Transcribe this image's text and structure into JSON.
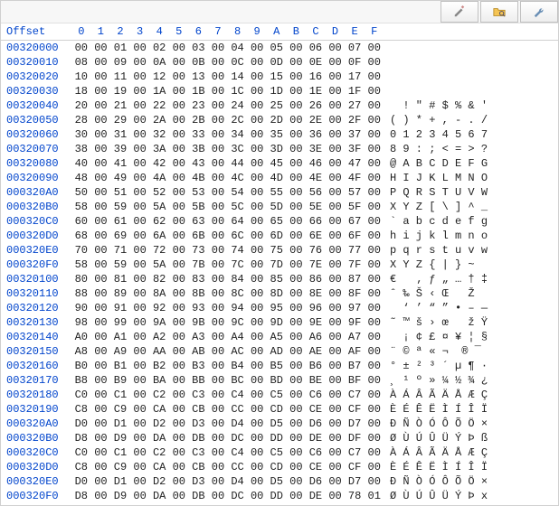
{
  "headers": {
    "offset_label": "Offset",
    "hex_cols": [
      "0",
      "1",
      "2",
      "3",
      "4",
      "5",
      "6",
      "7",
      "8",
      "9",
      "A",
      "B",
      "C",
      "D",
      "E",
      "F"
    ]
  },
  "rows": [
    {
      "offset": "00320000",
      "hex": [
        "00",
        "00",
        "01",
        "00",
        "02",
        "00",
        "03",
        "00",
        "04",
        "00",
        "05",
        "00",
        "06",
        "00",
        "07",
        "00"
      ],
      "asc": "                "
    },
    {
      "offset": "00320010",
      "hex": [
        "08",
        "00",
        "09",
        "00",
        "0A",
        "00",
        "0B",
        "00",
        "0C",
        "00",
        "0D",
        "00",
        "0E",
        "00",
        "0F",
        "00"
      ],
      "asc": "                "
    },
    {
      "offset": "00320020",
      "hex": [
        "10",
        "00",
        "11",
        "00",
        "12",
        "00",
        "13",
        "00",
        "14",
        "00",
        "15",
        "00",
        "16",
        "00",
        "17",
        "00"
      ],
      "asc": "                "
    },
    {
      "offset": "00320030",
      "hex": [
        "18",
        "00",
        "19",
        "00",
        "1A",
        "00",
        "1B",
        "00",
        "1C",
        "00",
        "1D",
        "00",
        "1E",
        "00",
        "1F",
        "00"
      ],
      "asc": "                "
    },
    {
      "offset": "00320040",
      "hex": [
        "20",
        "00",
        "21",
        "00",
        "22",
        "00",
        "23",
        "00",
        "24",
        "00",
        "25",
        "00",
        "26",
        "00",
        "27",
        "00"
      ],
      "asc": "  ! \" # $ % & ' "
    },
    {
      "offset": "00320050",
      "hex": [
        "28",
        "00",
        "29",
        "00",
        "2A",
        "00",
        "2B",
        "00",
        "2C",
        "00",
        "2D",
        "00",
        "2E",
        "00",
        "2F",
        "00"
      ],
      "asc": "( ) * + , - . / "
    },
    {
      "offset": "00320060",
      "hex": [
        "30",
        "00",
        "31",
        "00",
        "32",
        "00",
        "33",
        "00",
        "34",
        "00",
        "35",
        "00",
        "36",
        "00",
        "37",
        "00"
      ],
      "asc": "0 1 2 3 4 5 6 7 "
    },
    {
      "offset": "00320070",
      "hex": [
        "38",
        "00",
        "39",
        "00",
        "3A",
        "00",
        "3B",
        "00",
        "3C",
        "00",
        "3D",
        "00",
        "3E",
        "00",
        "3F",
        "00"
      ],
      "asc": "8 9 : ; < = > ? "
    },
    {
      "offset": "00320080",
      "hex": [
        "40",
        "00",
        "41",
        "00",
        "42",
        "00",
        "43",
        "00",
        "44",
        "00",
        "45",
        "00",
        "46",
        "00",
        "47",
        "00"
      ],
      "asc": "@ A B C D E F G "
    },
    {
      "offset": "00320090",
      "hex": [
        "48",
        "00",
        "49",
        "00",
        "4A",
        "00",
        "4B",
        "00",
        "4C",
        "00",
        "4D",
        "00",
        "4E",
        "00",
        "4F",
        "00"
      ],
      "asc": "H I J K L M N O "
    },
    {
      "offset": "000320A0",
      "hex": [
        "50",
        "00",
        "51",
        "00",
        "52",
        "00",
        "53",
        "00",
        "54",
        "00",
        "55",
        "00",
        "56",
        "00",
        "57",
        "00"
      ],
      "asc": "P Q R S T U V W "
    },
    {
      "offset": "000320B0",
      "hex": [
        "58",
        "00",
        "59",
        "00",
        "5A",
        "00",
        "5B",
        "00",
        "5C",
        "00",
        "5D",
        "00",
        "5E",
        "00",
        "5F",
        "00"
      ],
      "asc": "X Y Z [ \\ ] ^ _ "
    },
    {
      "offset": "000320C0",
      "hex": [
        "60",
        "00",
        "61",
        "00",
        "62",
        "00",
        "63",
        "00",
        "64",
        "00",
        "65",
        "00",
        "66",
        "00",
        "67",
        "00"
      ],
      "asc": "` a b c d e f g "
    },
    {
      "offset": "000320D0",
      "hex": [
        "68",
        "00",
        "69",
        "00",
        "6A",
        "00",
        "6B",
        "00",
        "6C",
        "00",
        "6D",
        "00",
        "6E",
        "00",
        "6F",
        "00"
      ],
      "asc": "h i j k l m n o "
    },
    {
      "offset": "000320E0",
      "hex": [
        "70",
        "00",
        "71",
        "00",
        "72",
        "00",
        "73",
        "00",
        "74",
        "00",
        "75",
        "00",
        "76",
        "00",
        "77",
        "00"
      ],
      "asc": "p q r s t u v w "
    },
    {
      "offset": "000320F0",
      "hex": [
        "58",
        "00",
        "59",
        "00",
        "5A",
        "00",
        "7B",
        "00",
        "7C",
        "00",
        "7D",
        "00",
        "7E",
        "00",
        "7F",
        "00"
      ],
      "asc": "X Y Z { | } ~   "
    },
    {
      "offset": "00320100",
      "hex": [
        "80",
        "00",
        "81",
        "00",
        "82",
        "00",
        "83",
        "00",
        "84",
        "00",
        "85",
        "00",
        "86",
        "00",
        "87",
        "00"
      ],
      "asc": "€   ‚ ƒ „ … † ‡ "
    },
    {
      "offset": "00320110",
      "hex": [
        "88",
        "00",
        "89",
        "00",
        "8A",
        "00",
        "8B",
        "00",
        "8C",
        "00",
        "8D",
        "00",
        "8E",
        "00",
        "8F",
        "00"
      ],
      "asc": "ˆ ‰ Š ‹ Œ   Ž   "
    },
    {
      "offset": "00320120",
      "hex": [
        "90",
        "00",
        "91",
        "00",
        "92",
        "00",
        "93",
        "00",
        "94",
        "00",
        "95",
        "00",
        "96",
        "00",
        "97",
        "00"
      ],
      "asc": "  ‘ ’ “ ” • – — "
    },
    {
      "offset": "00320130",
      "hex": [
        "98",
        "00",
        "99",
        "00",
        "9A",
        "00",
        "9B",
        "00",
        "9C",
        "00",
        "9D",
        "00",
        "9E",
        "00",
        "9F",
        "00"
      ],
      "asc": "˜ ™ š › œ   ž Ÿ "
    },
    {
      "offset": "00320140",
      "hex": [
        "A0",
        "00",
        "A1",
        "00",
        "A2",
        "00",
        "A3",
        "00",
        "A4",
        "00",
        "A5",
        "00",
        "A6",
        "00",
        "A7",
        "00"
      ],
      "asc": "  ¡ ¢ £ ¤ ¥ ¦ § "
    },
    {
      "offset": "00320150",
      "hex": [
        "A8",
        "00",
        "A9",
        "00",
        "AA",
        "00",
        "AB",
        "00",
        "AC",
        "00",
        "AD",
        "00",
        "AE",
        "00",
        "AF",
        "00"
      ],
      "asc": "¨ © ª « ¬ ­ ® ¯ "
    },
    {
      "offset": "00320160",
      "hex": [
        "B0",
        "00",
        "B1",
        "00",
        "B2",
        "00",
        "B3",
        "00",
        "B4",
        "00",
        "B5",
        "00",
        "B6",
        "00",
        "B7",
        "00"
      ],
      "asc": "° ± ² ³ ´ µ ¶ · "
    },
    {
      "offset": "00320170",
      "hex": [
        "B8",
        "00",
        "B9",
        "00",
        "BA",
        "00",
        "BB",
        "00",
        "BC",
        "00",
        "BD",
        "00",
        "BE",
        "00",
        "BF",
        "00"
      ],
      "asc": "¸ ¹ º » ¼ ½ ¾ ¿ "
    },
    {
      "offset": "00320180",
      "hex": [
        "C0",
        "00",
        "C1",
        "00",
        "C2",
        "00",
        "C3",
        "00",
        "C4",
        "00",
        "C5",
        "00",
        "C6",
        "00",
        "C7",
        "00"
      ],
      "asc": "À Á Â Ã Ä Å Æ Ç "
    },
    {
      "offset": "00320190",
      "hex": [
        "C8",
        "00",
        "C9",
        "00",
        "CA",
        "00",
        "CB",
        "00",
        "CC",
        "00",
        "CD",
        "00",
        "CE",
        "00",
        "CF",
        "00"
      ],
      "asc": "È É Ê Ë Ì Í Î Ï "
    },
    {
      "offset": "000320A0",
      "hex": [
        "D0",
        "00",
        "D1",
        "00",
        "D2",
        "00",
        "D3",
        "00",
        "D4",
        "00",
        "D5",
        "00",
        "D6",
        "00",
        "D7",
        "00"
      ],
      "asc": "Ð Ñ Ò Ó Ô Õ Ö × "
    },
    {
      "offset": "000320B0",
      "hex": [
        "D8",
        "00",
        "D9",
        "00",
        "DA",
        "00",
        "DB",
        "00",
        "DC",
        "00",
        "DD",
        "00",
        "DE",
        "00",
        "DF",
        "00"
      ],
      "asc": "Ø Ù Ú Û Ü Ý Þ ß "
    },
    {
      "offset": "000320C0",
      "hex": [
        "C0",
        "00",
        "C1",
        "00",
        "C2",
        "00",
        "C3",
        "00",
        "C4",
        "00",
        "C5",
        "00",
        "C6",
        "00",
        "C7",
        "00"
      ],
      "asc": "À Á Â Ã Ä Å Æ Ç "
    },
    {
      "offset": "000320D0",
      "hex": [
        "C8",
        "00",
        "C9",
        "00",
        "CA",
        "00",
        "CB",
        "00",
        "CC",
        "00",
        "CD",
        "00",
        "CE",
        "00",
        "CF",
        "00"
      ],
      "asc": "È É Ê Ë Ì Í Î Ï "
    },
    {
      "offset": "000320E0",
      "hex": [
        "D0",
        "00",
        "D1",
        "00",
        "D2",
        "00",
        "D3",
        "00",
        "D4",
        "00",
        "D5",
        "00",
        "D6",
        "00",
        "D7",
        "00"
      ],
      "asc": "Ð Ñ Ò Ó Ô Õ Ö × "
    },
    {
      "offset": "000320F0",
      "hex": [
        "D8",
        "00",
        "D9",
        "00",
        "DA",
        "00",
        "DB",
        "00",
        "DC",
        "00",
        "DD",
        "00",
        "DE",
        "00",
        "78",
        "01"
      ],
      "asc": "Ø Ù Ú Û Ü Ý Þ x "
    }
  ],
  "toolbar": {
    "icons": [
      "pencil-icon",
      "folder-search-icon",
      "wrench-icon"
    ]
  }
}
